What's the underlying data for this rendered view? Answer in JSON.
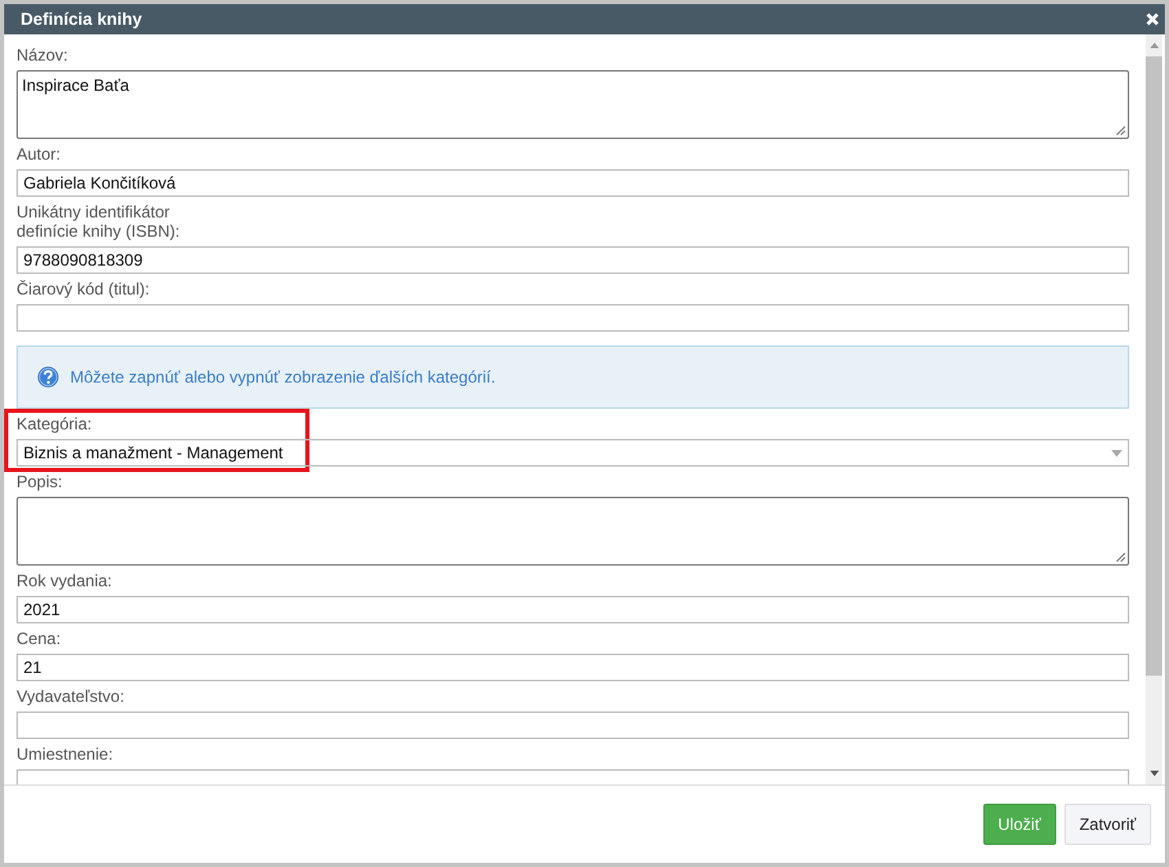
{
  "dialog": {
    "title": "Definícia knihy"
  },
  "fields": [
    {
      "kind": "textarea",
      "label": "Názov:",
      "value": "Inspirace Baťa",
      "highlighted": false
    },
    {
      "kind": "input",
      "label": "Autor:",
      "value": "Gabriela Končitíková",
      "highlighted": false
    },
    {
      "kind": "input",
      "label": "Unikátny identifikátor\ndefinície knihy (ISBN):",
      "value": "9788090818309",
      "highlighted": false
    },
    {
      "kind": "input",
      "label": "Čiarový kód (titul):",
      "highlighted": false
    },
    {
      "kind": "info",
      "text": "Môžete zapnúť alebo vypnúť zobrazenie ďalších kategórií."
    },
    {
      "kind": "select",
      "label": "Kategória:",
      "value": "Biznis a manažment - Management",
      "highlighted": true
    },
    {
      "kind": "textarea",
      "label": "Popis:",
      "highlighted": false
    },
    {
      "kind": "input",
      "label": "Rok vydania:",
      "value": "2021",
      "highlighted": false
    },
    {
      "kind": "input",
      "label": "Cena:",
      "value": "21",
      "highlighted": false
    },
    {
      "kind": "input",
      "label": "Vydavateľstvo:",
      "highlighted": false
    },
    {
      "kind": "input",
      "label": "Umiestnenie:",
      "highlighted": false
    }
  ],
  "buttons": [
    {
      "label": "Uložiť",
      "kind": "primary"
    },
    {
      "label": "Zatvoriť",
      "kind": "default"
    }
  ]
}
